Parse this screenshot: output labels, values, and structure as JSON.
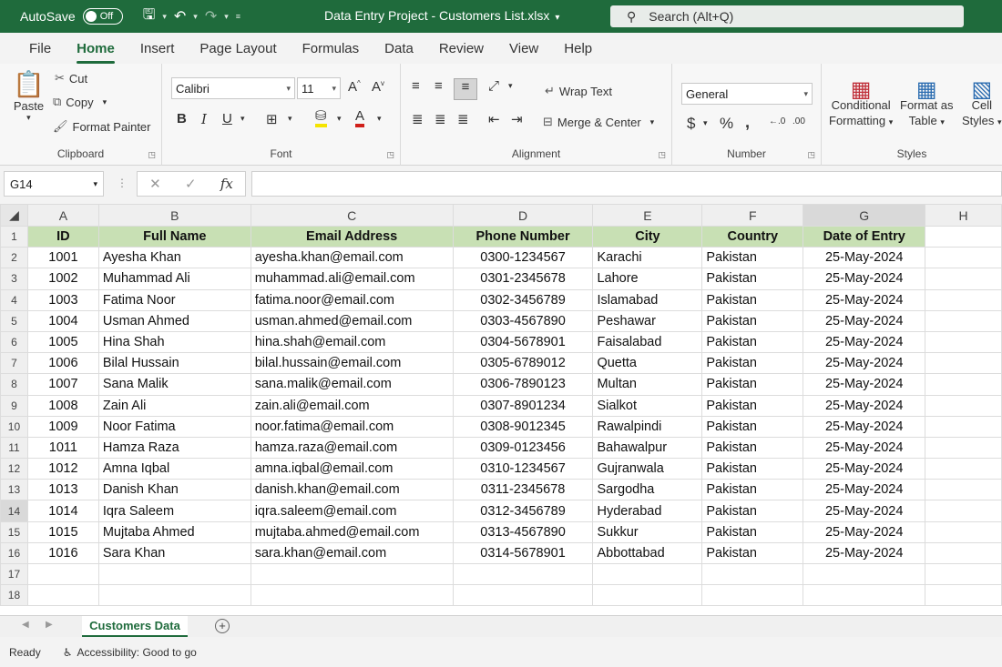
{
  "titlebar": {
    "autosave_label": "AutoSave",
    "autosave_state": "Off",
    "document_title": "Data Entry Project - Customers List.xlsx",
    "search_placeholder": "Search (Alt+Q)"
  },
  "ribbon_tabs": [
    "File",
    "Home",
    "Insert",
    "Page Layout",
    "Formulas",
    "Data",
    "Review",
    "View",
    "Help"
  ],
  "ribbon": {
    "clipboard": {
      "label": "Clipboard",
      "paste": "Paste",
      "cut": "Cut",
      "copy": "Copy",
      "format_painter": "Format Painter"
    },
    "font": {
      "label": "Font",
      "font_name": "Calibri",
      "font_size": "11"
    },
    "alignment": {
      "label": "Alignment",
      "wrap_text": "Wrap Text",
      "merge_center": "Merge & Center"
    },
    "number": {
      "label": "Number",
      "format": "General"
    },
    "styles": {
      "label": "Styles",
      "conditional_1": "Conditional",
      "conditional_2": "Formatting",
      "format_table_1": "Format as",
      "format_table_2": "Table",
      "cell_styles_1": "Cell",
      "cell_styles_2": "Styles"
    }
  },
  "formula_bar": {
    "name_box": "G14",
    "fx": "fx",
    "formula": ""
  },
  "sheet": {
    "columns": [
      "A",
      "B",
      "C",
      "D",
      "E",
      "F",
      "G",
      "H"
    ],
    "selected_column": "G",
    "selected_row": 14,
    "headers": [
      "ID",
      "Full Name",
      "Email Address",
      "Phone Number",
      "City",
      "Country",
      "Date of Entry"
    ],
    "rows": [
      [
        "1001",
        "Ayesha Khan",
        "ayesha.khan@email.com",
        "0300-1234567",
        "Karachi",
        "Pakistan",
        "25-May-2024"
      ],
      [
        "1002",
        "Muhammad Ali",
        "muhammad.ali@email.com",
        "0301-2345678",
        "Lahore",
        "Pakistan",
        "25-May-2024"
      ],
      [
        "1003",
        "Fatima Noor",
        "fatima.noor@email.com",
        "0302-3456789",
        "Islamabad",
        "Pakistan",
        "25-May-2024"
      ],
      [
        "1004",
        "Usman Ahmed",
        "usman.ahmed@email.com",
        "0303-4567890",
        "Peshawar",
        "Pakistan",
        "25-May-2024"
      ],
      [
        "1005",
        "Hina Shah",
        "hina.shah@email.com",
        "0304-5678901",
        "Faisalabad",
        "Pakistan",
        "25-May-2024"
      ],
      [
        "1006",
        "Bilal Hussain",
        "bilal.hussain@email.com",
        "0305-6789012",
        "Quetta",
        "Pakistan",
        "25-May-2024"
      ],
      [
        "1007",
        "Sana Malik",
        "sana.malik@email.com",
        "0306-7890123",
        "Multan",
        "Pakistan",
        "25-May-2024"
      ],
      [
        "1008",
        "Zain Ali",
        "zain.ali@email.com",
        "0307-8901234",
        "Sialkot",
        "Pakistan",
        "25-May-2024"
      ],
      [
        "1009",
        "Noor Fatima",
        "noor.fatima@email.com",
        "0308-9012345",
        "Rawalpindi",
        "Pakistan",
        "25-May-2024"
      ],
      [
        "1011",
        "Hamza Raza",
        "hamza.raza@email.com",
        "0309-0123456",
        "Bahawalpur",
        "Pakistan",
        "25-May-2024"
      ],
      [
        "1012",
        "Amna Iqbal",
        "amna.iqbal@email.com",
        "0310-1234567",
        "Gujranwala",
        "Pakistan",
        "25-May-2024"
      ],
      [
        "1013",
        "Danish Khan",
        "danish.khan@email.com",
        "0311-2345678",
        "Sargodha",
        "Pakistan",
        "25-May-2024"
      ],
      [
        "1014",
        "Iqra Saleem",
        "iqra.saleem@email.com",
        "0312-3456789",
        "Hyderabad",
        "Pakistan",
        "25-May-2024"
      ],
      [
        "1015",
        "Mujtaba Ahmed",
        "mujtaba.ahmed@email.com",
        "0313-4567890",
        "Sukkur",
        "Pakistan",
        "25-May-2024"
      ],
      [
        "1016",
        "Sara Khan",
        "sara.khan@email.com",
        "0314-5678901",
        "Abbottabad",
        "Pakistan",
        "25-May-2024"
      ]
    ],
    "empty_rows": [
      17,
      18
    ]
  },
  "sheet_tab": {
    "name": "Customers Data",
    "add_symbol": "+"
  },
  "status": {
    "ready": "Ready",
    "accessibility": "Accessibility: Good to go"
  }
}
